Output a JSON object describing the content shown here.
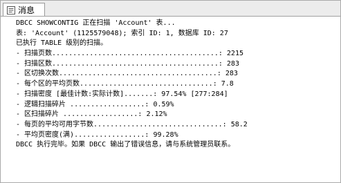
{
  "tab": {
    "label": "消息",
    "icon": "message-icon"
  },
  "messages": [
    "DBCC SHOWCONTIG 正在扫描 'Account' 表...",
    "表: 'Account' (1125579048); 索引 ID: 1, 数据库 ID: 27",
    "已执行 TABLE 级别的扫描。",
    "- 扫描页数........................................: 2215",
    "- 扫描区数........................................: 283",
    "- 区切换次数......................................: 283",
    "- 每个区的平均页数................................: 7.8",
    "- 扫描密度 [最佳计数:实际计数].......: 97.54% [277:284]",
    "- 逻辑扫描碎片 ..................: 0.59%",
    "- 区扫描碎片 ..................: 2.12%",
    "- 每页的平均可用字节数...............................: 58.2",
    "- 平均页密度(满).................: 99.28%",
    "DBCC 执行完毕。如果 DBCC 输出了错误信息，请与系统管理员联系。"
  ]
}
